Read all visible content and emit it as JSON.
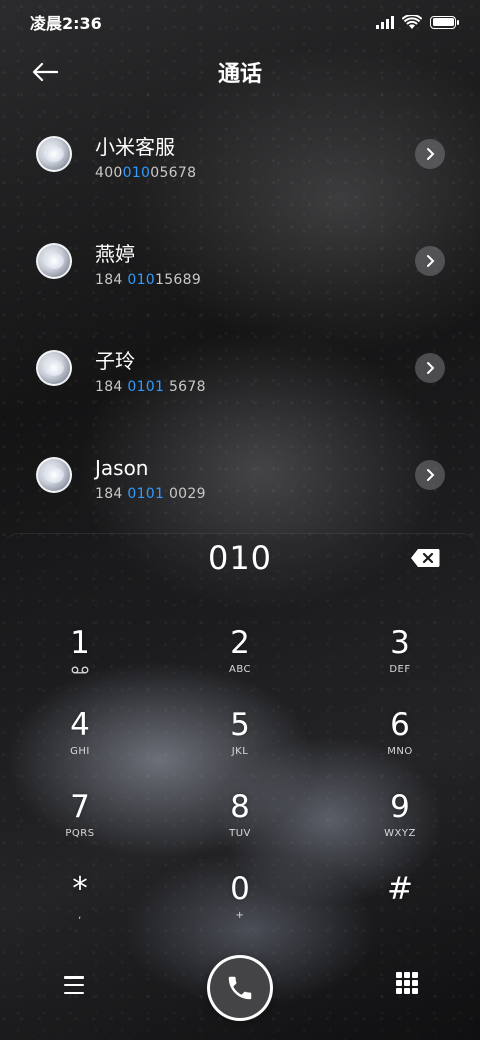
{
  "status_bar": {
    "time": "凌晨2:36",
    "icons": [
      "signal-icon",
      "wifi-icon",
      "battery-icon"
    ]
  },
  "header": {
    "back_icon": "arrow-left-icon",
    "title": "通话"
  },
  "contacts": [
    {
      "name": "小米客服",
      "number_parts": [
        "400",
        "010",
        "05678"
      ]
    },
    {
      "name": "燕婷",
      "number_parts": [
        "184 ",
        "010",
        "15689"
      ]
    },
    {
      "name": "子玲",
      "number_parts": [
        "184 ",
        "0101",
        " 5678"
      ]
    },
    {
      "name": "Jason",
      "number_parts": [
        "184 ",
        "0101",
        " 0029"
      ]
    }
  ],
  "dialpad": {
    "display": "010",
    "delete_icon": "backspace-icon",
    "keys": [
      {
        "digit": "1",
        "letters": "",
        "sub_icon": "voicemail-icon"
      },
      {
        "digit": "2",
        "letters": "ABC"
      },
      {
        "digit": "3",
        "letters": "DEF"
      },
      {
        "digit": "4",
        "letters": "GHI"
      },
      {
        "digit": "5",
        "letters": "JKL"
      },
      {
        "digit": "6",
        "letters": "MNO"
      },
      {
        "digit": "7",
        "letters": "PQRS"
      },
      {
        "digit": "8",
        "letters": "TUV"
      },
      {
        "digit": "9",
        "letters": "WXYZ"
      },
      {
        "digit": "*",
        "letters": ","
      },
      {
        "digit": "0",
        "letters": "+"
      },
      {
        "digit": "#",
        "letters": ""
      }
    ]
  },
  "bottom_bar": {
    "menu_icon": "menu-icon",
    "call_icon": "phone-icon",
    "keypad_icon": "dialpad-icon"
  },
  "colors": {
    "highlight": "#2f9bff",
    "text": "#ffffff"
  }
}
